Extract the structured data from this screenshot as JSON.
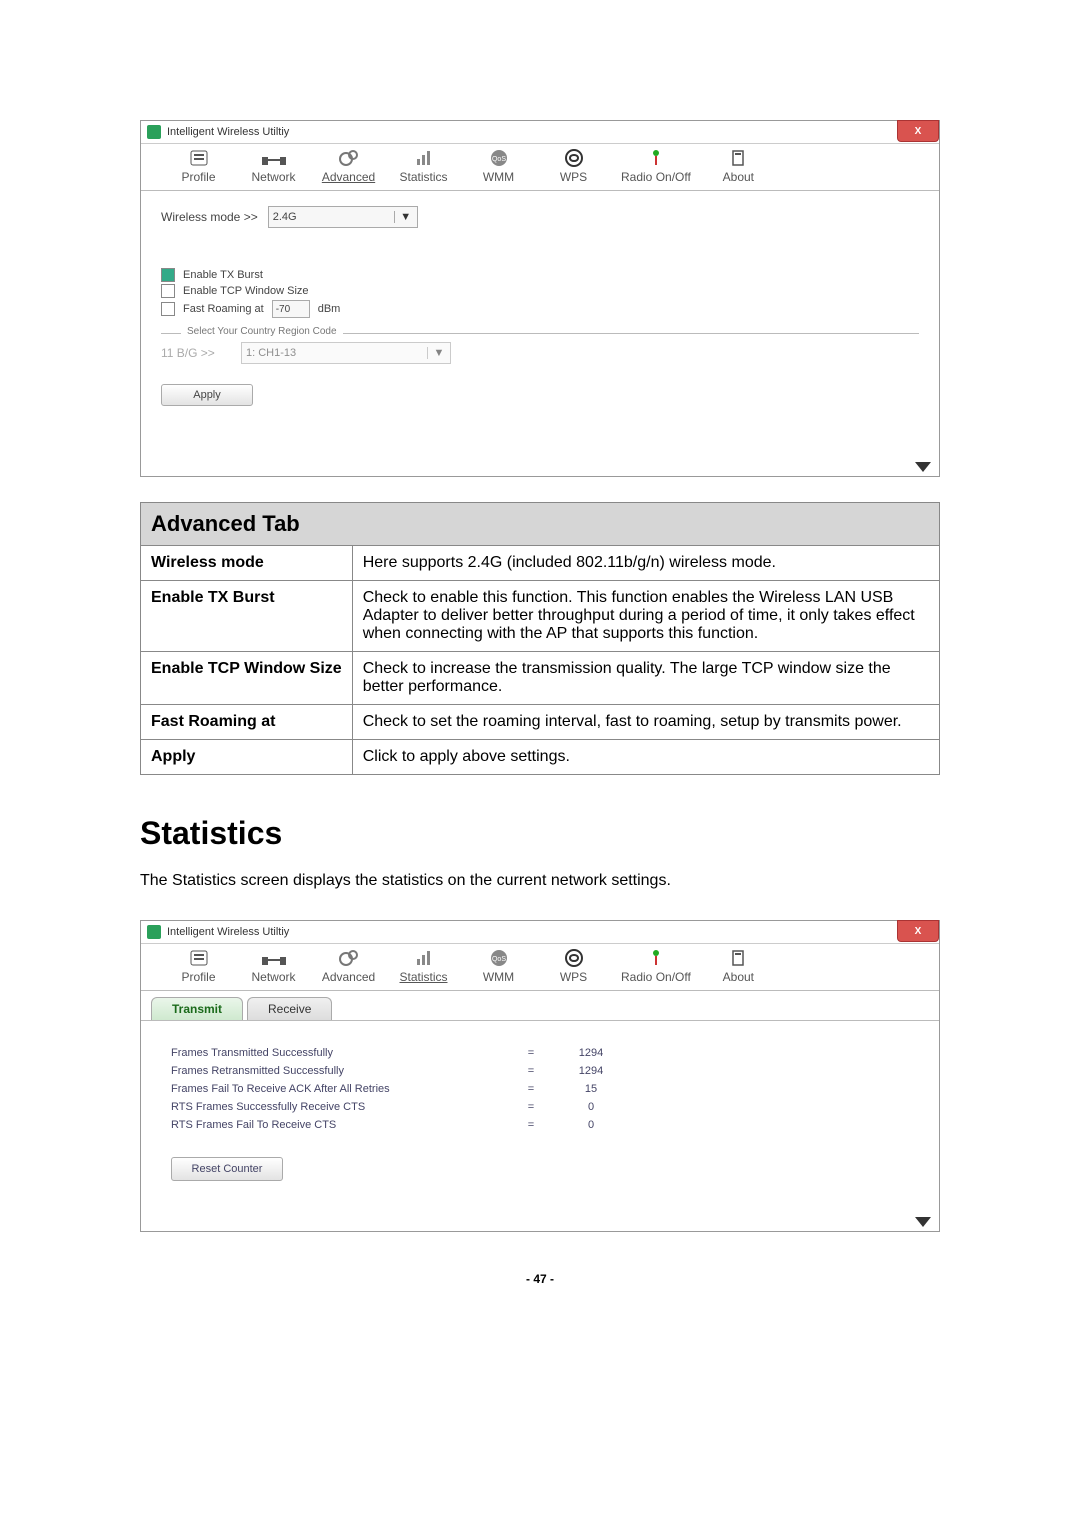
{
  "window": {
    "title": "Intelligent Wireless Utiltiy",
    "close_label": "X"
  },
  "toolbar": {
    "items": [
      {
        "label": "Profile"
      },
      {
        "label": "Network"
      },
      {
        "label": "Advanced"
      },
      {
        "label": "Statistics"
      },
      {
        "label": "WMM"
      },
      {
        "label": "WPS"
      },
      {
        "label": "Radio On/Off"
      },
      {
        "label": "About"
      }
    ]
  },
  "advanced": {
    "wireless_mode_label": "Wireless mode >>",
    "wireless_mode_value": "2.4G",
    "enable_tx_burst": "Enable TX Burst",
    "enable_tcp_window": "Enable TCP Window Size",
    "fast_roaming_label": "Fast Roaming at",
    "fast_roaming_value": "-70",
    "fast_roaming_unit": "dBm",
    "region_group": "Select Your Country Region Code",
    "region_label": "11 B/G >>",
    "region_value": "1: CH1-13",
    "apply": "Apply"
  },
  "table": {
    "title": "Advanced Tab",
    "rows": [
      {
        "k": "Wireless mode",
        "v": "Here supports 2.4G (included 802.11b/g/n) wireless mode."
      },
      {
        "k": "Enable TX Burst",
        "v": "Check to enable this function. This function enables the Wireless LAN USB Adapter to deliver better throughput during a period of time, it only takes effect when connecting with the AP that supports this function."
      },
      {
        "k": "Enable TCP Window Size",
        "v": "Check to increase the transmission quality. The large TCP window size the better performance."
      },
      {
        "k": "Fast Roaming at",
        "v": "Check to set the roaming interval, fast to roaming, setup by transmits power."
      },
      {
        "k": "Apply",
        "v": "Click to apply above settings."
      }
    ]
  },
  "section": {
    "heading": "Statistics",
    "intro": "The Statistics screen displays the statistics on the current network settings."
  },
  "stats": {
    "tabs": {
      "transmit": "Transmit",
      "receive": "Receive"
    },
    "rows": [
      {
        "label": "Frames Transmitted Successfully",
        "value": "1294"
      },
      {
        "label": "Frames Retransmitted Successfully",
        "value": "1294"
      },
      {
        "label": "Frames Fail To Receive ACK After All Retries",
        "value": "15"
      },
      {
        "label": "RTS Frames Successfully Receive CTS",
        "value": "0"
      },
      {
        "label": "RTS Frames Fail To Receive CTS",
        "value": "0"
      }
    ],
    "reset": "Reset Counter"
  },
  "pagenum": "- 47 -"
}
